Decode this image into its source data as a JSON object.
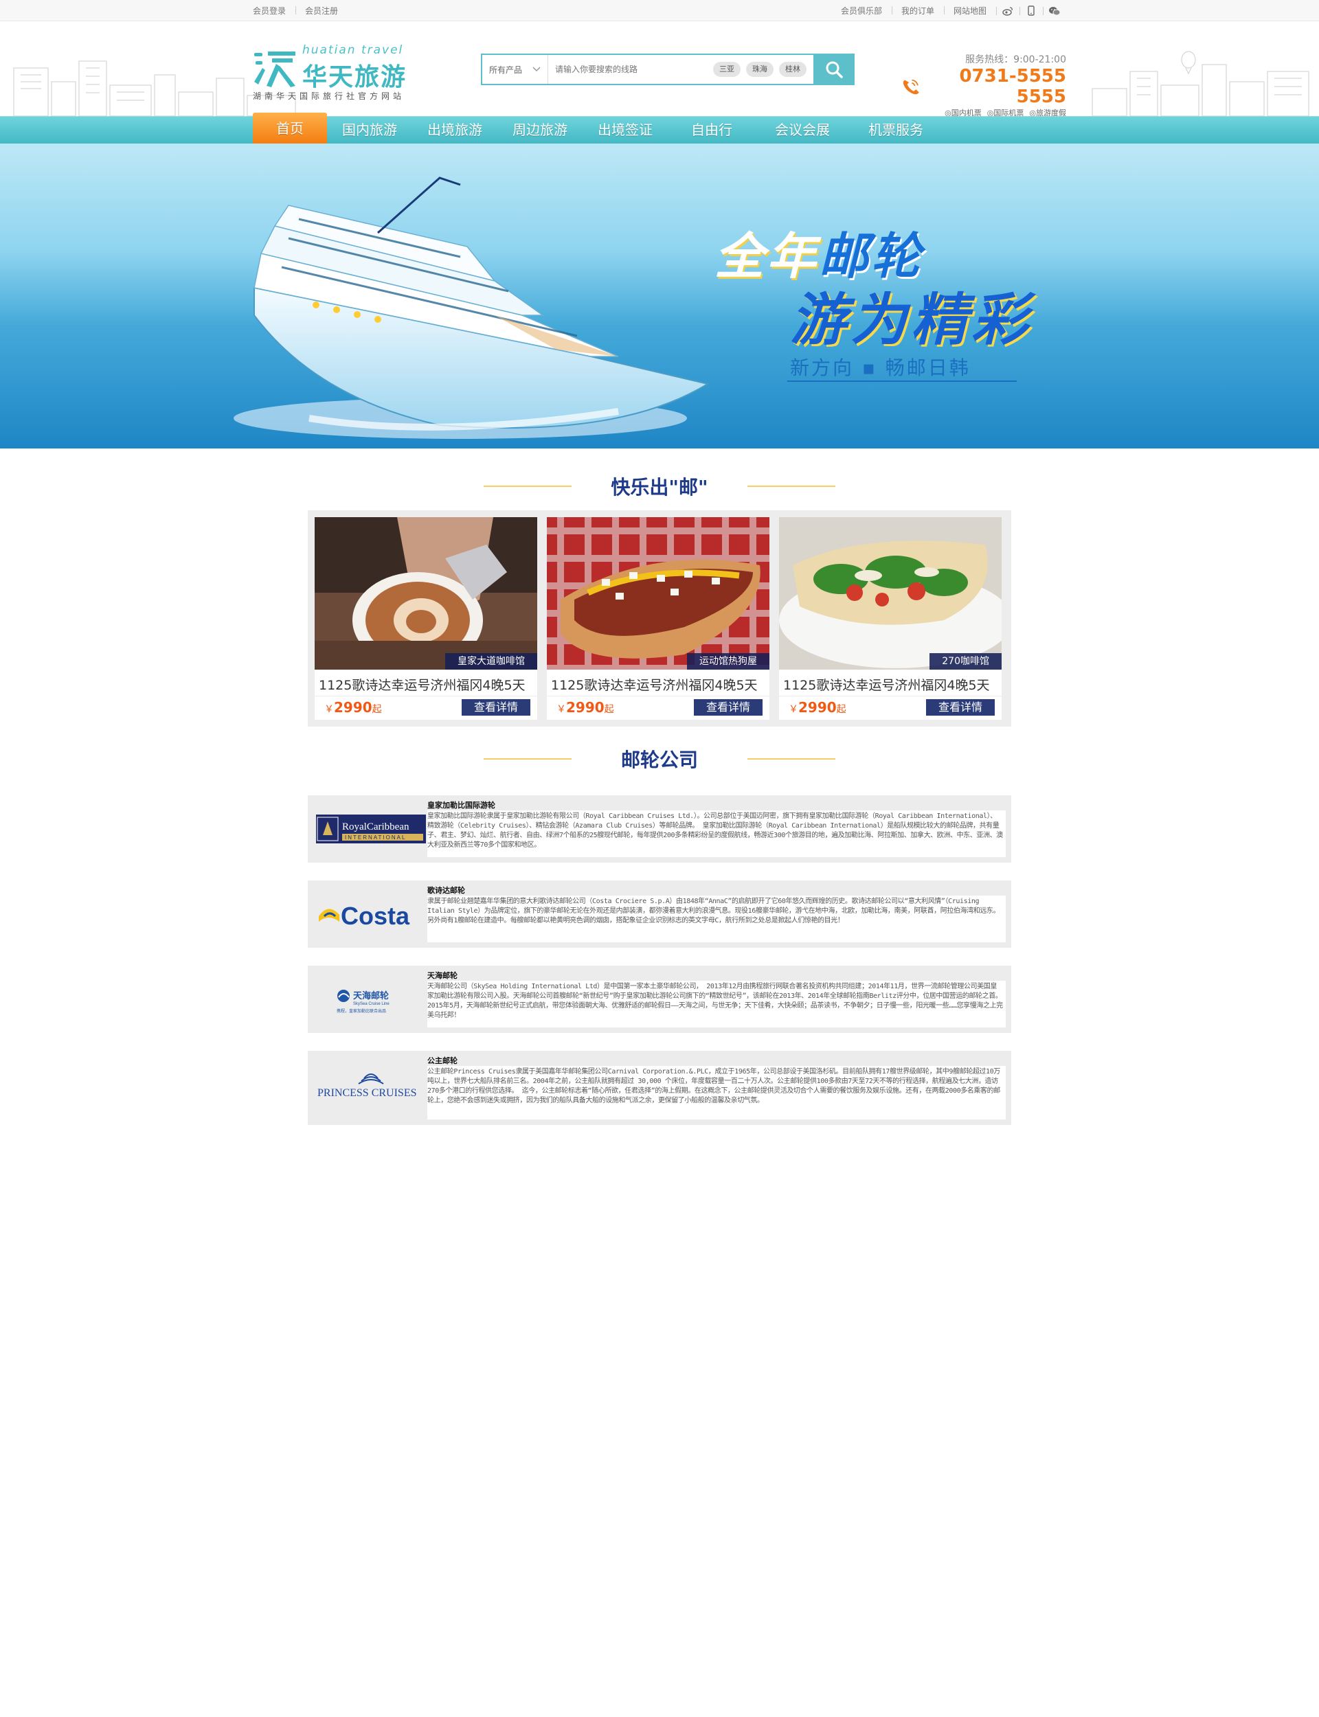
{
  "topbar": {
    "login": "会员登录",
    "register": "会员注册",
    "club": "会员俱乐部",
    "orders": "我的订单",
    "sitemap": "网站地图",
    "icons": [
      "weibo-icon",
      "mobile-icon",
      "wechat-icon"
    ]
  },
  "header": {
    "logo_en": "huatian travel",
    "logo_cn": "华天旅游",
    "logo_sub": "湖南华天国际旅行社官方网站",
    "search": {
      "category": "所有产品",
      "placeholder": "请输入你要搜索的线路",
      "tags": [
        "三亚",
        "珠海",
        "桂林"
      ]
    },
    "hotline": {
      "time": "服务热线：9:00-21:00",
      "number": "0731-5555 5555",
      "links": [
        "◎国内机票",
        "◎国际机票",
        "◎旅游度假"
      ]
    }
  },
  "nav": {
    "items": [
      "首页",
      "国内旅游",
      "出境旅游",
      "周边旅游",
      "出境签证",
      "自由行",
      "会议会展",
      "机票服务"
    ],
    "active_index": 0
  },
  "banner": {
    "title1_white": "全年",
    "title1_blue": "邮轮",
    "title2": "游为精彩",
    "subtitle": "新方向 ▪ 畅邮日韩"
  },
  "fun_section": {
    "title": "快乐出\"邮\"",
    "cards": [
      {
        "badge": "皇家大道咖啡馆",
        "title": "1125歌诗达幸运号济州福冈4晚5天",
        "price_symbol": "￥",
        "price": "2990",
        "price_suffix": "起",
        "button": "查看详情"
      },
      {
        "badge": "运动馆热狗屋",
        "title": "1125歌诗达幸运号济州福冈4晚5天",
        "price_symbol": "￥",
        "price": "2990",
        "price_suffix": "起",
        "button": "查看详情"
      },
      {
        "badge": "270咖啡馆",
        "title": "1125歌诗达幸运号济州福冈4晚5天",
        "price_symbol": "￥",
        "price": "2990",
        "price_suffix": "起",
        "button": "查看详情"
      }
    ]
  },
  "company_section": {
    "title": "邮轮公司",
    "companies": [
      {
        "logo_text": "RoyalCaribbean",
        "logo_sub": "INTERNATIONAL",
        "name": "皇家加勒比国际游轮",
        "desc": "皇家加勒比国际游轮隶属于皇家加勒比游轮有限公司（Royal Caribbean Cruises Ltd.）。公司总部位于美国迈阿密，旗下拥有皇家加勒比国际游轮（Royal Caribbean International）、精致游轮（Celebrity Cruises）、精钻会游轮（Azamara Club Cruises）等邮轮品牌。 皇家加勒比国际游轮（Royal Caribbean International）是船队规模比较大的邮轮品牌，共有量子、君主、梦幻、灿烂、航行者、自由、绿洲7个船系的25艘现代邮轮，每年提供200多条精彩纷呈的度假航线，畅游近300个旅游目的地，遍及加勒比海、阿拉斯加、加拿大、欧洲、中东、亚洲、澳大利亚及新西兰等70多个国家和地区。"
      },
      {
        "logo_text": "Costa",
        "logo_sub": "",
        "name": "歌诗达邮轮",
        "desc": "隶属于邮轮业翘楚嘉年华集团的意大利歌诗达邮轮公司（Costa Crociere S.p.A）由1848年“AnnaC”的启航即开了它60年悠久而辉煌的历史。歌诗达邮轮公司以“意大利风情”（Cruising Italian Style）为品牌定位，旗下的豪华邮轮无论在外观还是内部装潢，都弥漫着意大利的浪漫气息。现役16艘豪华邮轮，游弋在地中海，北欧，加勒比海，南美，阿联酋，阿拉伯海湾和远东。另外尚有1艘邮轮在建造中。每艘邮轮都以艳黄明亮色调的烟囱，搭配象征企业识别标志的英文字母C，航行所到之处总是掀起人们惊艳的目光！"
      },
      {
        "logo_text": "天海邮轮",
        "logo_sub": "SkySea Cruise Line",
        "logo_sub2": "携程，皇家加勒比联合出品",
        "name": "天海邮轮",
        "desc": "天海邮轮公司（SkySea Holding International Ltd）是中国第一家本土豪华邮轮公司， 2013年12月由携程旅行网联合著名投资机构共同组建；2014年11月，世界一流邮轮管理公司美国皇家加勒比游轮有限公司入股。天海邮轮公司首艘邮轮“新世纪号”购于皇家加勒比游轮公司旗下的“精致世纪号”，该邮轮在2013年、2014年全球邮轮指南Berlitz评分中，位居中国营运的邮轮之首。2015年5月，天海邮轮新世纪号正式启航，带您体验面朝大海、优雅舒适的邮轮假日——天海之间，与世无争；天下佳肴，大快朵颐；品茶读书，不争朝夕；日子慢一些，阳光暖一些……您享慢海之上完美乌托邦！"
      },
      {
        "logo_text": "PRINCESS CRUISES",
        "logo_sub": "",
        "name": "公主邮轮",
        "desc": "公主邮轮Princess Cruises隶属于美国嘉年华邮轮集团公司Carnival Corporation.&.PLC，成立于1965年，公司总部设于美国洛杉矶。目前船队拥有17艘世界级邮轮，其中9艘邮轮超过10万吨以上，世界七大船队排名前三名。2004年之前，公主船队就拥有超过 30,000 个床位，年度载容量一百二十万人次。公主邮轮提供100多款由7天至72天不等的行程选择，航程遍及七大洲，造访 270多个港口的行程供您选择。 迄今，公主邮轮标志着“随心所欲，任君选择”的海上假期。在这概念下，公主邮轮提供灵活及切合个人需要的餐饮服务及娱乐设施。还有，在两载2000多名乘客的邮轮上，您绝不会感到迷失或拥挤，因为我们的船队具备大船的设施和气派之余，更保留了小船般的温馨及亲切气氛。"
      }
    ]
  },
  "colors": {
    "teal": "#5dbfc9",
    "orange": "#f47c10",
    "navy": "#1e3a8a",
    "price": "#f05a14"
  }
}
